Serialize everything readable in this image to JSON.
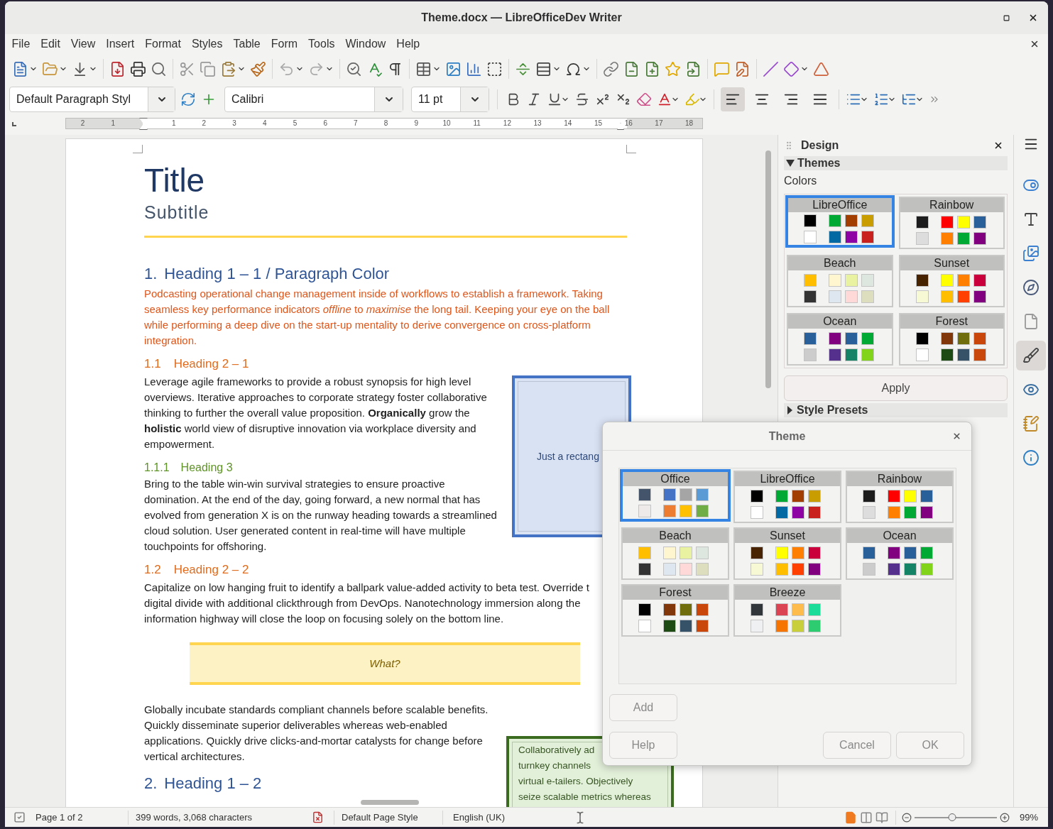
{
  "window": {
    "title": "Theme.docx — LibreOfficeDev Writer"
  },
  "menu": [
    "File",
    "Edit",
    "View",
    "Insert",
    "Format",
    "Styles",
    "Table",
    "Form",
    "Tools",
    "Window",
    "Help"
  ],
  "toolbar": {
    "paragraph_style": "Default Paragraph Styl",
    "font_name": "Calibri",
    "font_size": "11 pt",
    "alignment": [
      {
        "kind": "left",
        "selected": true
      },
      {
        "kind": "center",
        "selected": false
      },
      {
        "kind": "right",
        "selected": false
      },
      {
        "kind": "justify",
        "selected": false
      }
    ]
  },
  "ruler": {
    "labels": [
      "2",
      "1",
      "1",
      "2",
      "3",
      "4",
      "5",
      "6",
      "7",
      "8",
      "9",
      "10",
      "11",
      "12",
      "13",
      "14",
      "15",
      "16",
      "17",
      "18"
    ]
  },
  "document": {
    "title": "Title",
    "subtitle": "Subtitle",
    "blocks": [
      {
        "kind": "heading1",
        "number": "1.",
        "text": "Heading 1 – 1 / Paragraph Color"
      },
      {
        "kind": "accent_paragraph",
        "text": "Podcasting operational change management inside of workflows to establish a framework. Taking seamless key performance indicators *offline* to *maximise* the long tail. Keeping your eye on the ball while performing a deep dive on the start-up mentality to derive convergence on cross-platform integration."
      },
      {
        "kind": "heading2",
        "number": "1.1",
        "text": "Heading 2 – 1"
      },
      {
        "kind": "paragraph",
        "text": "Leverage agile frameworks to provide a robust synopsis for high level overviews. Iterative approaches to corporate strategy foster collaborative thinking to further the overall value proposition. **Organically** grow the **holistic** world view of disruptive innovation via workplace diversity and empowerment."
      },
      {
        "kind": "shape",
        "text": "Just a rectang"
      },
      {
        "kind": "heading3",
        "number": "1.1.1",
        "text": "Heading 3"
      },
      {
        "kind": "paragraph",
        "text": "Bring to the table win-win survival strategies to ensure proactive domination. At the end of the day, going forward, a new normal that has evolved from generation X is on the runway heading towards a streamlined cloud solution. User generated content in real-time will have multiple touchpoints for offshoring."
      },
      {
        "kind": "heading2",
        "number": "1.2",
        "text": "Heading 2 – 2"
      },
      {
        "kind": "narrow_paragraph",
        "text": "Capitalize on low hanging fruit to identify a ballpark value-added activity to beta test. Override t digital divide with additional clickthrough from DevOps. Nanotechnology immersion along the information highway will close the loop on focusing solely on the bottom line."
      },
      {
        "kind": "callout",
        "text": "What?"
      },
      {
        "kind": "paragraph",
        "text": "Globally incubate standards compliant channels before scalable benefits. Quickly disseminate superior deliverables whereas web-enabled applications. Quickly drive clicks-and-mortar catalysts for change before vertical architectures."
      },
      {
        "kind": "heading1",
        "number": "2.",
        "text": "Heading 1 – 2"
      },
      {
        "kind": "frame",
        "lines": [
          "Collaboratively ad",
          "turnkey channels",
          "virtual e-tailers. Objectively",
          "seize scalable metrics whereas"
        ]
      }
    ]
  },
  "sidebar": {
    "title": "Design",
    "themes_section": {
      "label": "Themes",
      "expanded": true
    },
    "group_label": "Colors",
    "themes": [
      {
        "name": "LibreOffice",
        "selected": true,
        "colors": [
          {
            "color": "#000000"
          },
          {
            "color": "#00a933"
          },
          {
            "color": "#a33e03"
          },
          {
            "color": "#c99c00"
          },
          {
            "color": "#ffffff"
          },
          {
            "color": "#0369a3"
          },
          {
            "color": "#8e03a3"
          },
          {
            "color": "#c9211e"
          }
        ]
      },
      {
        "name": "Rainbow",
        "selected": false,
        "colors": [
          {
            "color": "#1c1c1c"
          },
          {
            "color": "#ff0000"
          },
          {
            "color": "#ffff00"
          },
          {
            "color": "#2a6099"
          },
          {
            "color": "#dddddd"
          },
          {
            "color": "#ff8000"
          },
          {
            "color": "#00a933"
          },
          {
            "color": "#800080"
          }
        ]
      },
      {
        "name": "Beach",
        "selected": false,
        "colors": [
          {
            "color": "#ffbf00"
          },
          {
            "color": "#fff5ce"
          },
          {
            "color": "#e8f2a1"
          },
          {
            "color": "#dee6e0"
          },
          {
            "color": "#333333"
          },
          {
            "color": "#dee7f0"
          },
          {
            "color": "#ffd8d8"
          },
          {
            "color": "#dddebd"
          }
        ]
      },
      {
        "name": "Sunset",
        "selected": false,
        "colors": [
          {
            "color": "#482300"
          },
          {
            "color": "#ffff00"
          },
          {
            "color": "#ff8000"
          },
          {
            "color": "#c9003b"
          },
          {
            "color": "#f6f9d4"
          },
          {
            "color": "#ffbf00"
          },
          {
            "color": "#ff4000"
          },
          {
            "color": "#800080"
          }
        ]
      },
      {
        "name": "Ocean",
        "selected": false,
        "colors": [
          {
            "color": "#2a6099"
          },
          {
            "color": "#800080"
          },
          {
            "color": "#2a6099"
          },
          {
            "color": "#00a933"
          },
          {
            "color": "#cccccc"
          },
          {
            "color": "#55308d"
          },
          {
            "color": "#158466"
          },
          {
            "color": "#81d41a"
          }
        ]
      },
      {
        "name": "Forest",
        "selected": false,
        "colors": [
          {
            "color": "#000000"
          },
          {
            "color": "#813709"
          },
          {
            "color": "#706e0c"
          },
          {
            "color": "#c9470a"
          },
          {
            "color": "#ffffff"
          },
          {
            "color": "#1e4a13"
          },
          {
            "color": "#355269"
          },
          {
            "color": "#c9470a"
          }
        ]
      }
    ],
    "apply_button": "Apply",
    "presets_section": {
      "label": "Style Presets",
      "expanded": false
    }
  },
  "sidebar_tabs": [
    {
      "kind": "properties",
      "selected": false
    },
    {
      "kind": "styles",
      "selected": false
    },
    {
      "kind": "gallery",
      "selected": false
    },
    {
      "kind": "navigator",
      "selected": false
    },
    {
      "kind": "page",
      "selected": false
    },
    {
      "kind": "design",
      "selected": true
    },
    {
      "kind": "inspector",
      "selected": false
    },
    {
      "kind": "changes",
      "selected": false
    },
    {
      "kind": "accessibility",
      "selected": false
    }
  ],
  "dialog": {
    "title": "Theme",
    "themes": [
      {
        "name": "Office",
        "selected": true,
        "colors": [
          {
            "color": "#44546a"
          },
          {
            "color": "#4472c4"
          },
          {
            "color": "#a5a5a5"
          },
          {
            "color": "#5b9bd5"
          },
          {
            "color": "#eeeaea"
          },
          {
            "color": "#ed7d31"
          },
          {
            "color": "#ffc000"
          },
          {
            "color": "#70ad47"
          }
        ]
      },
      {
        "name": "LibreOffice",
        "selected": false,
        "colors": [
          {
            "color": "#000000"
          },
          {
            "color": "#00a933"
          },
          {
            "color": "#a33e03"
          },
          {
            "color": "#c99c00"
          },
          {
            "color": "#ffffff"
          },
          {
            "color": "#0369a3"
          },
          {
            "color": "#8e03a3"
          },
          {
            "color": "#c9211e"
          }
        ]
      },
      {
        "name": "Rainbow",
        "selected": false,
        "colors": [
          {
            "color": "#1c1c1c"
          },
          {
            "color": "#ff0000"
          },
          {
            "color": "#ffff00"
          },
          {
            "color": "#2a6099"
          },
          {
            "color": "#dddddd"
          },
          {
            "color": "#ff8000"
          },
          {
            "color": "#00a933"
          },
          {
            "color": "#800080"
          }
        ]
      },
      {
        "name": "Beach",
        "selected": false,
        "colors": [
          {
            "color": "#ffbf00"
          },
          {
            "color": "#fff5ce"
          },
          {
            "color": "#e8f2a1"
          },
          {
            "color": "#dee6e0"
          },
          {
            "color": "#333333"
          },
          {
            "color": "#dee7f0"
          },
          {
            "color": "#ffd8d8"
          },
          {
            "color": "#dddebd"
          }
        ]
      },
      {
        "name": "Sunset",
        "selected": false,
        "colors": [
          {
            "color": "#482300"
          },
          {
            "color": "#ffff00"
          },
          {
            "color": "#ff8000"
          },
          {
            "color": "#c9003b"
          },
          {
            "color": "#f6f9d4"
          },
          {
            "color": "#ffbf00"
          },
          {
            "color": "#ff4000"
          },
          {
            "color": "#800080"
          }
        ]
      },
      {
        "name": "Ocean",
        "selected": false,
        "colors": [
          {
            "color": "#2a6099"
          },
          {
            "color": "#800080"
          },
          {
            "color": "#2a6099"
          },
          {
            "color": "#00a933"
          },
          {
            "color": "#cccccc"
          },
          {
            "color": "#55308d"
          },
          {
            "color": "#158466"
          },
          {
            "color": "#81d41a"
          }
        ]
      },
      {
        "name": "Forest",
        "selected": false,
        "colors": [
          {
            "color": "#000000"
          },
          {
            "color": "#813709"
          },
          {
            "color": "#706e0c"
          },
          {
            "color": "#c9470a"
          },
          {
            "color": "#ffffff"
          },
          {
            "color": "#1e4a13"
          },
          {
            "color": "#355269"
          },
          {
            "color": "#c9470a"
          }
        ]
      },
      {
        "name": "Breeze",
        "selected": false,
        "colors": [
          {
            "color": "#31363b"
          },
          {
            "color": "#da4453"
          },
          {
            "color": "#fdbc4b"
          },
          {
            "color": "#1cdc9a"
          },
          {
            "color": "#eff0f1"
          },
          {
            "color": "#f67400"
          },
          {
            "color": "#c9ce3b"
          },
          {
            "color": "#2ecc71"
          }
        ]
      }
    ],
    "buttons": [
      "Add",
      "Help",
      "Cancel",
      "OK"
    ]
  },
  "status_bar": {
    "page": "Page 1 of 2",
    "word_count": "399 words, 3,068 characters",
    "page_style": "Default Page Style",
    "language": "English (UK)",
    "view_modes": [
      {
        "kind": "single",
        "selected": true
      },
      {
        "kind": "multi",
        "selected": false
      },
      {
        "kind": "book",
        "selected": false
      }
    ],
    "zoom": {
      "level": 0.46,
      "reading": "99%"
    }
  }
}
